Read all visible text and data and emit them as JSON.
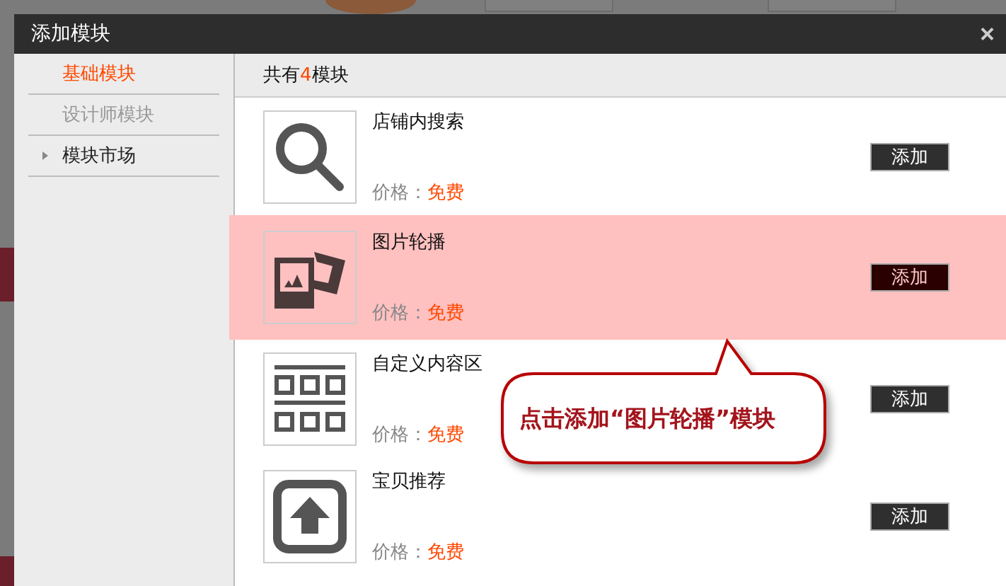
{
  "window": {
    "title": "添加模块",
    "close": "×"
  },
  "sidebar": {
    "items": [
      {
        "label": "基础模块",
        "selected": true,
        "disabled": false,
        "kind": "plain"
      },
      {
        "label": "设计师模块",
        "selected": false,
        "disabled": true,
        "kind": "plain"
      },
      {
        "label": "模块市场",
        "selected": false,
        "disabled": false,
        "kind": "group"
      }
    ]
  },
  "header": {
    "prefix": "共有",
    "count": "4",
    "suffix": "模块"
  },
  "modules": [
    {
      "kind": "search",
      "name": "店铺内搜索",
      "price_label": "价格：",
      "price": "免费",
      "button": "添加",
      "selected": false
    },
    {
      "kind": "slides",
      "name": "图片轮播",
      "price_label": "价格：",
      "price": "免费",
      "button": "添加",
      "selected": true
    },
    {
      "kind": "grid",
      "name": "自定义内容区",
      "price_label": "价格：",
      "price": "免费",
      "button": "添加",
      "selected": false
    },
    {
      "kind": "upload",
      "name": "宝贝推荐",
      "price_label": "价格：",
      "price": "免费",
      "button": "添加",
      "selected": false
    }
  ],
  "callout": {
    "text": "点击添加“图片轮播”模块"
  }
}
